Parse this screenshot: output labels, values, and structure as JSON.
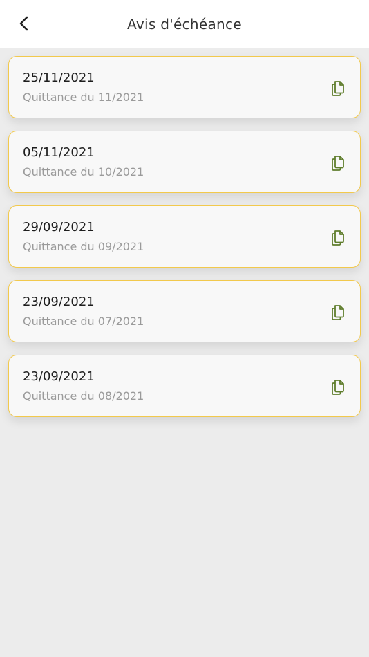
{
  "header": {
    "title": "Avis d'échéance",
    "back_icon": "chevron-left-icon"
  },
  "colors": {
    "accent_border": "#f2c94c",
    "icon_green": "#5f7d2c",
    "background": "#ececec"
  },
  "items": [
    {
      "date": "25/11/2021",
      "label": "Quittance du 11/2021",
      "icon": "documents-icon"
    },
    {
      "date": "05/11/2021",
      "label": "Quittance du 10/2021",
      "icon": "documents-icon"
    },
    {
      "date": "29/09/2021",
      "label": "Quittance du 09/2021",
      "icon": "documents-icon"
    },
    {
      "date": "23/09/2021",
      "label": "Quittance du 07/2021",
      "icon": "documents-icon"
    },
    {
      "date": "23/09/2021",
      "label": "Quittance du 08/2021",
      "icon": "documents-icon"
    }
  ]
}
